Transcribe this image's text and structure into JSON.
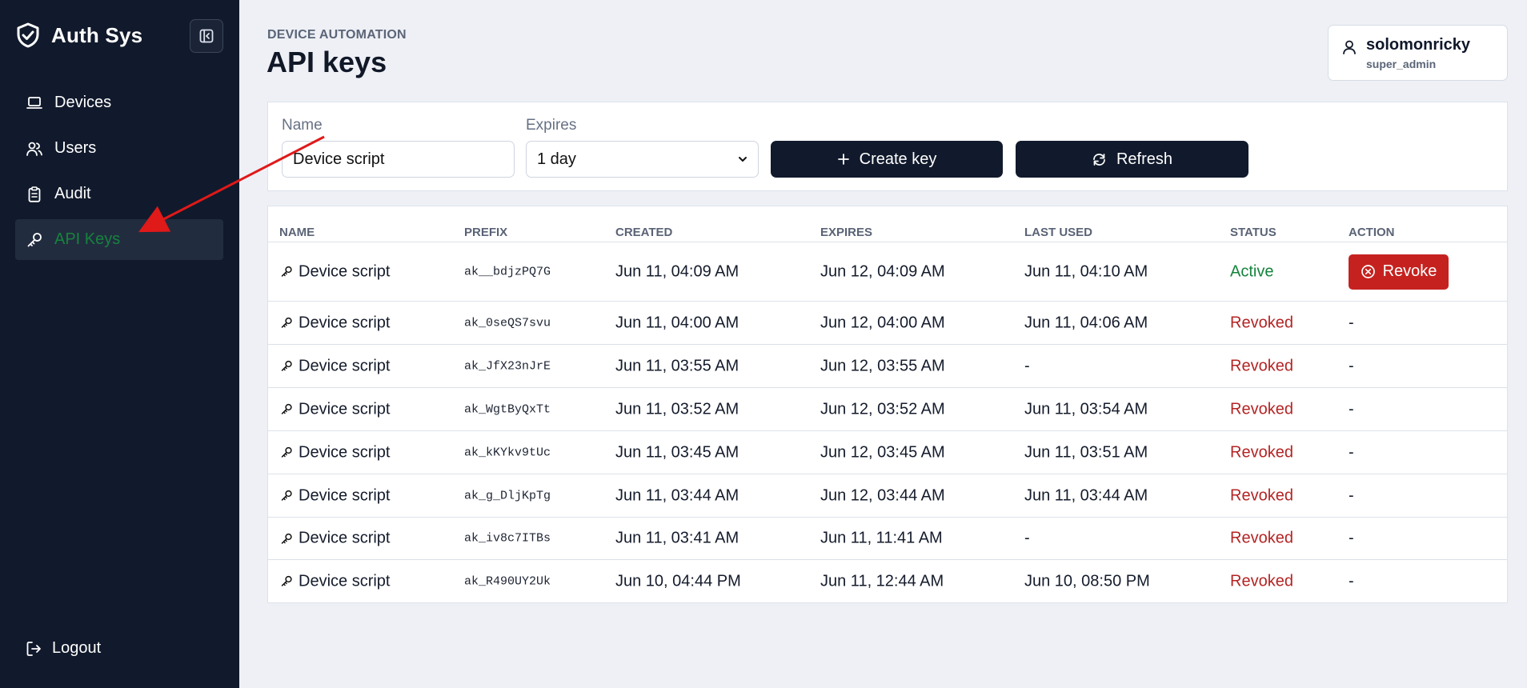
{
  "sidebar": {
    "brand": "Auth Sys",
    "collapse_icon": "panel-left-icon",
    "items": [
      {
        "label": "Devices",
        "icon": "laptop-icon"
      },
      {
        "label": "Users",
        "icon": "users-icon"
      },
      {
        "label": "Audit",
        "icon": "clipboard-icon"
      },
      {
        "label": "API Keys",
        "icon": "key-icon",
        "active": true
      }
    ],
    "logout": "Logout"
  },
  "header": {
    "eyebrow": "DEVICE AUTOMATION",
    "title": "API keys",
    "user": {
      "name": "solomonricky",
      "role": "super_admin"
    }
  },
  "form": {
    "name_label": "Name",
    "name_value": "Device script",
    "expires_label": "Expires",
    "expires_value": "1 day",
    "create_label": "Create key",
    "refresh_label": "Refresh"
  },
  "table": {
    "columns": [
      "NAME",
      "PREFIX",
      "CREATED",
      "EXPIRES",
      "LAST USED",
      "STATUS",
      "ACTION"
    ],
    "rows": [
      {
        "name": "Device script",
        "prefix": "ak__bdjzPQ7G",
        "created": "Jun 11, 04:09 AM",
        "expires": "Jun 12, 04:09 AM",
        "last_used": "Jun 11, 04:10 AM",
        "status": "Active",
        "action": "Revoke"
      },
      {
        "name": "Device script",
        "prefix": "ak_0seQS7svu",
        "created": "Jun 11, 04:00 AM",
        "expires": "Jun 12, 04:00 AM",
        "last_used": "Jun 11, 04:06 AM",
        "status": "Revoked",
        "action": "-"
      },
      {
        "name": "Device script",
        "prefix": "ak_JfX23nJrE",
        "created": "Jun 11, 03:55 AM",
        "expires": "Jun 12, 03:55 AM",
        "last_used": "-",
        "status": "Revoked",
        "action": "-"
      },
      {
        "name": "Device script",
        "prefix": "ak_WgtByQxTt",
        "created": "Jun 11, 03:52 AM",
        "expires": "Jun 12, 03:52 AM",
        "last_used": "Jun 11, 03:54 AM",
        "status": "Revoked",
        "action": "-"
      },
      {
        "name": "Device script",
        "prefix": "ak_kKYkv9tUc",
        "created": "Jun 11, 03:45 AM",
        "expires": "Jun 12, 03:45 AM",
        "last_used": "Jun 11, 03:51 AM",
        "status": "Revoked",
        "action": "-"
      },
      {
        "name": "Device script",
        "prefix": "ak_g_DljKpTg",
        "created": "Jun 11, 03:44 AM",
        "expires": "Jun 12, 03:44 AM",
        "last_used": "Jun 11, 03:44 AM",
        "status": "Revoked",
        "action": "-"
      },
      {
        "name": "Device script",
        "prefix": "ak_iv8c7ITBs",
        "created": "Jun 11, 03:41 AM",
        "expires": "Jun 11, 11:41 AM",
        "last_used": "-",
        "status": "Revoked",
        "action": "-"
      },
      {
        "name": "Device script",
        "prefix": "ak_R490UY2Uk",
        "created": "Jun 10, 04:44 PM",
        "expires": "Jun 11, 12:44 AM",
        "last_used": "Jun 10, 08:50 PM",
        "status": "Revoked",
        "action": "-"
      }
    ]
  },
  "colors": {
    "sidebar_bg": "#111a2c",
    "accent_dark": "#111a2c",
    "active": "#16833d",
    "revoked": "#b42323",
    "revoke_button": "#c5221f",
    "annotation_arrow": "#e01919"
  }
}
